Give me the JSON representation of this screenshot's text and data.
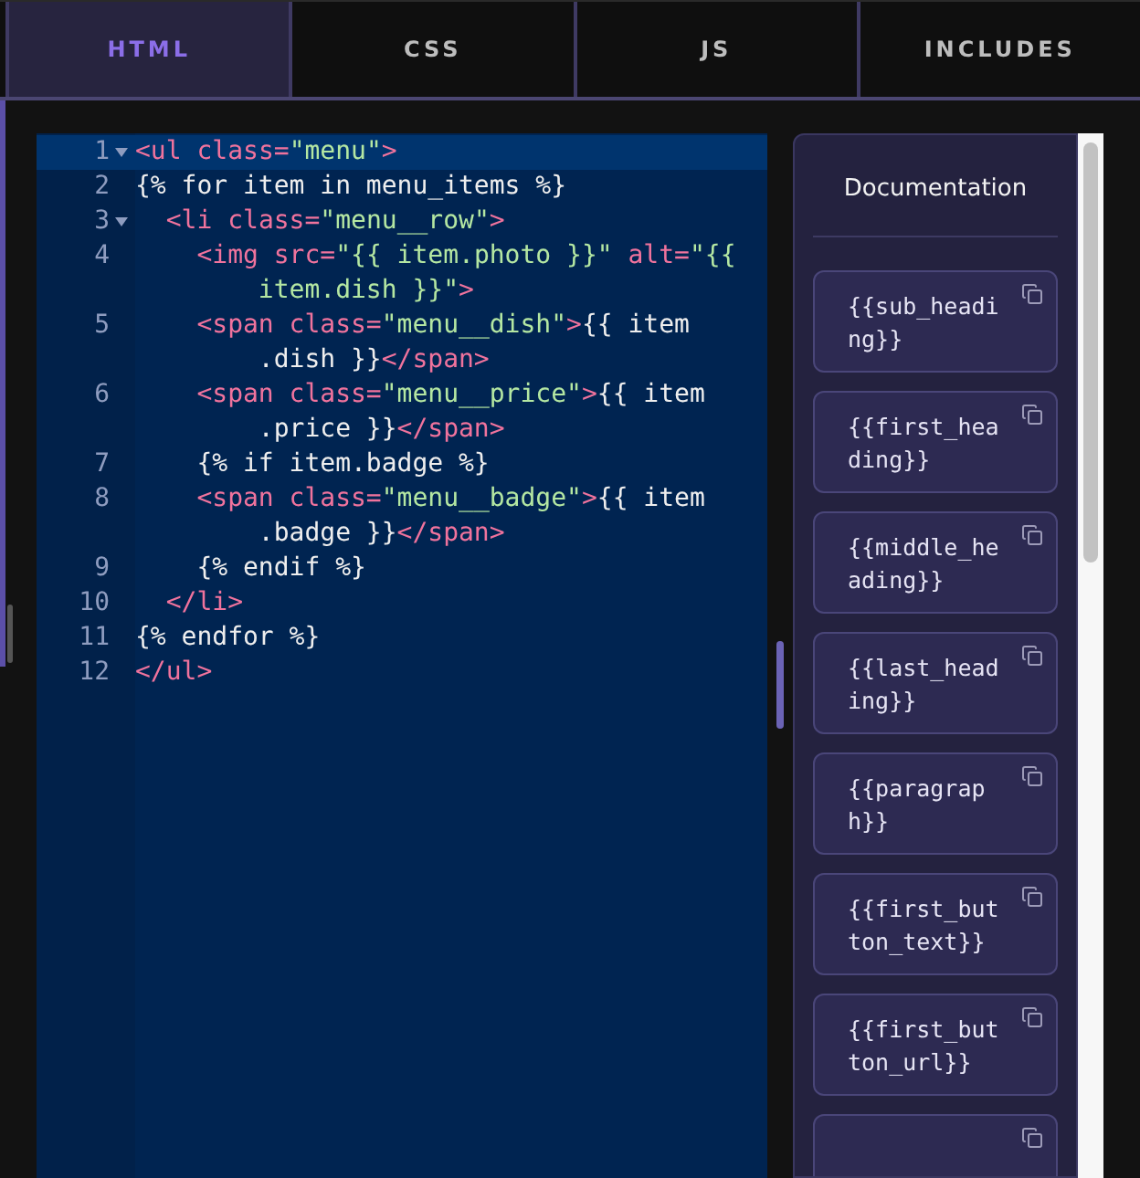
{
  "tabs": [
    {
      "label": "HTML",
      "selected": true
    },
    {
      "label": "CSS",
      "selected": false
    },
    {
      "label": "JS",
      "selected": false
    },
    {
      "label": "INCLUDES",
      "selected": false
    }
  ],
  "editor": {
    "lines": [
      {
        "number": "1",
        "foldable": true,
        "active": true,
        "tokens": [
          {
            "kind": "tag",
            "text": "<ul"
          },
          {
            "kind": "attr",
            "text": " class="
          },
          {
            "kind": "string",
            "text": "\"menu\""
          },
          {
            "kind": "tag",
            "text": ">"
          }
        ]
      },
      {
        "number": "2",
        "foldable": false,
        "active": false,
        "tokens": [
          {
            "kind": "text",
            "text": "{% for item in menu_items %}"
          }
        ]
      },
      {
        "number": "3",
        "foldable": true,
        "active": false,
        "tokens": [
          {
            "kind": "tag",
            "text": "  <li"
          },
          {
            "kind": "attr",
            "text": " class="
          },
          {
            "kind": "string",
            "text": "\"menu__row\""
          },
          {
            "kind": "tag",
            "text": ">"
          }
        ]
      },
      {
        "number": "4",
        "foldable": false,
        "active": false,
        "tokens": [
          {
            "kind": "tag",
            "text": "    <img"
          },
          {
            "kind": "attr",
            "text": " src="
          },
          {
            "kind": "string",
            "text": "\"{{ item.photo }}\""
          },
          {
            "kind": "attr",
            "text": " alt="
          },
          {
            "kind": "string",
            "text": "\"{{"
          }
        ],
        "continuation": [
          {
            "kind": "string",
            "text": "item.dish }}\""
          },
          {
            "kind": "tag",
            "text": ">"
          }
        ]
      },
      {
        "number": "5",
        "foldable": false,
        "active": false,
        "tokens": [
          {
            "kind": "tag",
            "text": "    <span"
          },
          {
            "kind": "attr",
            "text": " class="
          },
          {
            "kind": "string",
            "text": "\"menu__dish\""
          },
          {
            "kind": "tag",
            "text": ">"
          },
          {
            "kind": "text",
            "text": "{{ item"
          }
        ],
        "continuation": [
          {
            "kind": "text",
            "text": ".dish }}"
          },
          {
            "kind": "tag",
            "text": "</span>"
          }
        ]
      },
      {
        "number": "6",
        "foldable": false,
        "active": false,
        "tokens": [
          {
            "kind": "tag",
            "text": "    <span"
          },
          {
            "kind": "attr",
            "text": " class="
          },
          {
            "kind": "string",
            "text": "\"menu__price\""
          },
          {
            "kind": "tag",
            "text": ">"
          },
          {
            "kind": "text",
            "text": "{{ item"
          }
        ],
        "continuation": [
          {
            "kind": "text",
            "text": ".price }}"
          },
          {
            "kind": "tag",
            "text": "</span>"
          }
        ]
      },
      {
        "number": "7",
        "foldable": false,
        "active": false,
        "tokens": [
          {
            "kind": "text",
            "text": "    {% if item.badge %}"
          }
        ]
      },
      {
        "number": "8",
        "foldable": false,
        "active": false,
        "tokens": [
          {
            "kind": "tag",
            "text": "    <span"
          },
          {
            "kind": "attr",
            "text": " class="
          },
          {
            "kind": "string",
            "text": "\"menu__badge\""
          },
          {
            "kind": "tag",
            "text": ">"
          },
          {
            "kind": "text",
            "text": "{{ item"
          }
        ],
        "continuation": [
          {
            "kind": "text",
            "text": ".badge }}"
          },
          {
            "kind": "tag",
            "text": "</span>"
          }
        ]
      },
      {
        "number": "9",
        "foldable": false,
        "active": false,
        "tokens": [
          {
            "kind": "text",
            "text": "    {% endif %}"
          }
        ]
      },
      {
        "number": "10",
        "foldable": false,
        "active": false,
        "tokens": [
          {
            "kind": "tag",
            "text": "  </li>"
          }
        ]
      },
      {
        "number": "11",
        "foldable": false,
        "active": false,
        "tokens": [
          {
            "kind": "text",
            "text": "{% endfor %}"
          }
        ]
      },
      {
        "number": "12",
        "foldable": false,
        "active": false,
        "tokens": [
          {
            "kind": "tag",
            "text": "</ul>"
          }
        ]
      }
    ]
  },
  "documentation": {
    "title": "Documentation",
    "items": [
      {
        "kind": "variable",
        "text": "{{sub_heading}}"
      },
      {
        "kind": "variable",
        "text": "{{first_heading}}"
      },
      {
        "kind": "variable",
        "text": "{{middle_heading}}"
      },
      {
        "kind": "variable",
        "text": "{{last_heading}}"
      },
      {
        "kind": "variable",
        "text": "{{paragraph}}"
      },
      {
        "kind": "variable",
        "text": "{{first_button_text}}"
      },
      {
        "kind": "variable",
        "text": "{{first_button_url}}"
      },
      {
        "kind": "partial"
      }
    ]
  }
}
